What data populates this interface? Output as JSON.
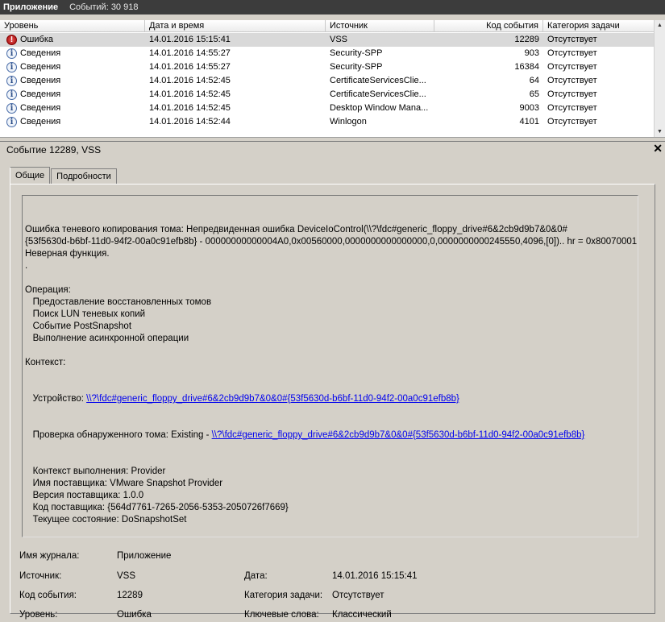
{
  "titlebar": {
    "title": "Приложение",
    "events": "Событий: 30 918"
  },
  "columns": {
    "level": "Уровень",
    "date": "Дата и время",
    "source": "Источник",
    "code": "Код события",
    "category": "Категория задачи"
  },
  "events": [
    {
      "level": "Ошибка",
      "type": "error",
      "date": "14.01.2016 15:15:41",
      "source": "VSS",
      "code": "12289",
      "category": "Отсутствует"
    },
    {
      "level": "Сведения",
      "type": "info",
      "date": "14.01.2016 14:55:27",
      "source": "Security-SPP",
      "code": "903",
      "category": "Отсутствует"
    },
    {
      "level": "Сведения",
      "type": "info",
      "date": "14.01.2016 14:55:27",
      "source": "Security-SPP",
      "code": "16384",
      "category": "Отсутствует"
    },
    {
      "level": "Сведения",
      "type": "info",
      "date": "14.01.2016 14:52:45",
      "source": "CertificateServicesClie...",
      "code": "64",
      "category": "Отсутствует"
    },
    {
      "level": "Сведения",
      "type": "info",
      "date": "14.01.2016 14:52:45",
      "source": "CertificateServicesClie...",
      "code": "65",
      "category": "Отсутствует"
    },
    {
      "level": "Сведения",
      "type": "info",
      "date": "14.01.2016 14:52:45",
      "source": "Desktop Window Mana...",
      "code": "9003",
      "category": "Отсутствует"
    },
    {
      "level": "Сведения",
      "type": "info",
      "date": "14.01.2016 14:52:44",
      "source": "Winlogon",
      "code": "4101",
      "category": "Отсутствует"
    }
  ],
  "detail": {
    "title": "Событие 12289, VSS",
    "close_glyph": "✕",
    "tabs": [
      "Общие",
      "Подробности"
    ],
    "text_lines": [
      "Ошибка теневого копирования тома: Непредвиденная ошибка DeviceIoControl(\\\\?\\fdc#generic_floppy_drive#6&2cb9d9b7&0&0#",
      "{53f5630d-b6bf-11d0-94f2-00a0c91efb8b} - 00000000000004A0,0x00560000,0000000000000000,0,0000000000245550,4096,[0]).. hr = 0x80070001,",
      "Неверная функция.",
      ".",
      "",
      "Операция:",
      "   Предоставление восстановленных томов",
      "   Поиск LUN теневых копий",
      "   Событие PostSnapshot",
      "   Выполнение асинхронной операции",
      "",
      "Контекст:"
    ],
    "device_label": "   Устройство: ",
    "device_link": "\\\\?\\fdc#generic_floppy_drive#6&2cb9d9b7&0&0#{53f5630d-b6bf-11d0-94f2-00a0c91efb8b}",
    "check_label": "   Проверка обнаруженного тома: Existing - ",
    "check_link": "\\\\?\\fdc#generic_floppy_drive#6&2cb9d9b7&0&0#{53f5630d-b6bf-11d0-94f2-00a0c91efb8b}",
    "tail_lines": [
      "   Контекст выполнения: Provider",
      "   Имя поставщика: VMware Snapshot Provider",
      "   Версия поставщика: 1.0.0",
      "   Код поставщика: {564d7761-7265-2056-5353-2050726f7669}",
      "   Текущее состояние: DoSnapshotSet"
    ]
  },
  "meta": {
    "log_name_label": "Имя журнала:",
    "log_name": "Приложение",
    "source_label": "Источник:",
    "source": "VSS",
    "date_label": "Дата:",
    "date": "14.01.2016 15:15:41",
    "code_label": "Код события:",
    "code": "12289",
    "category_label": "Категория задачи:",
    "category": "Отсутствует",
    "level_label": "Уровень:",
    "level": "Ошибка",
    "keywords_label": "Ключевые слова:",
    "keywords": "Классический"
  }
}
